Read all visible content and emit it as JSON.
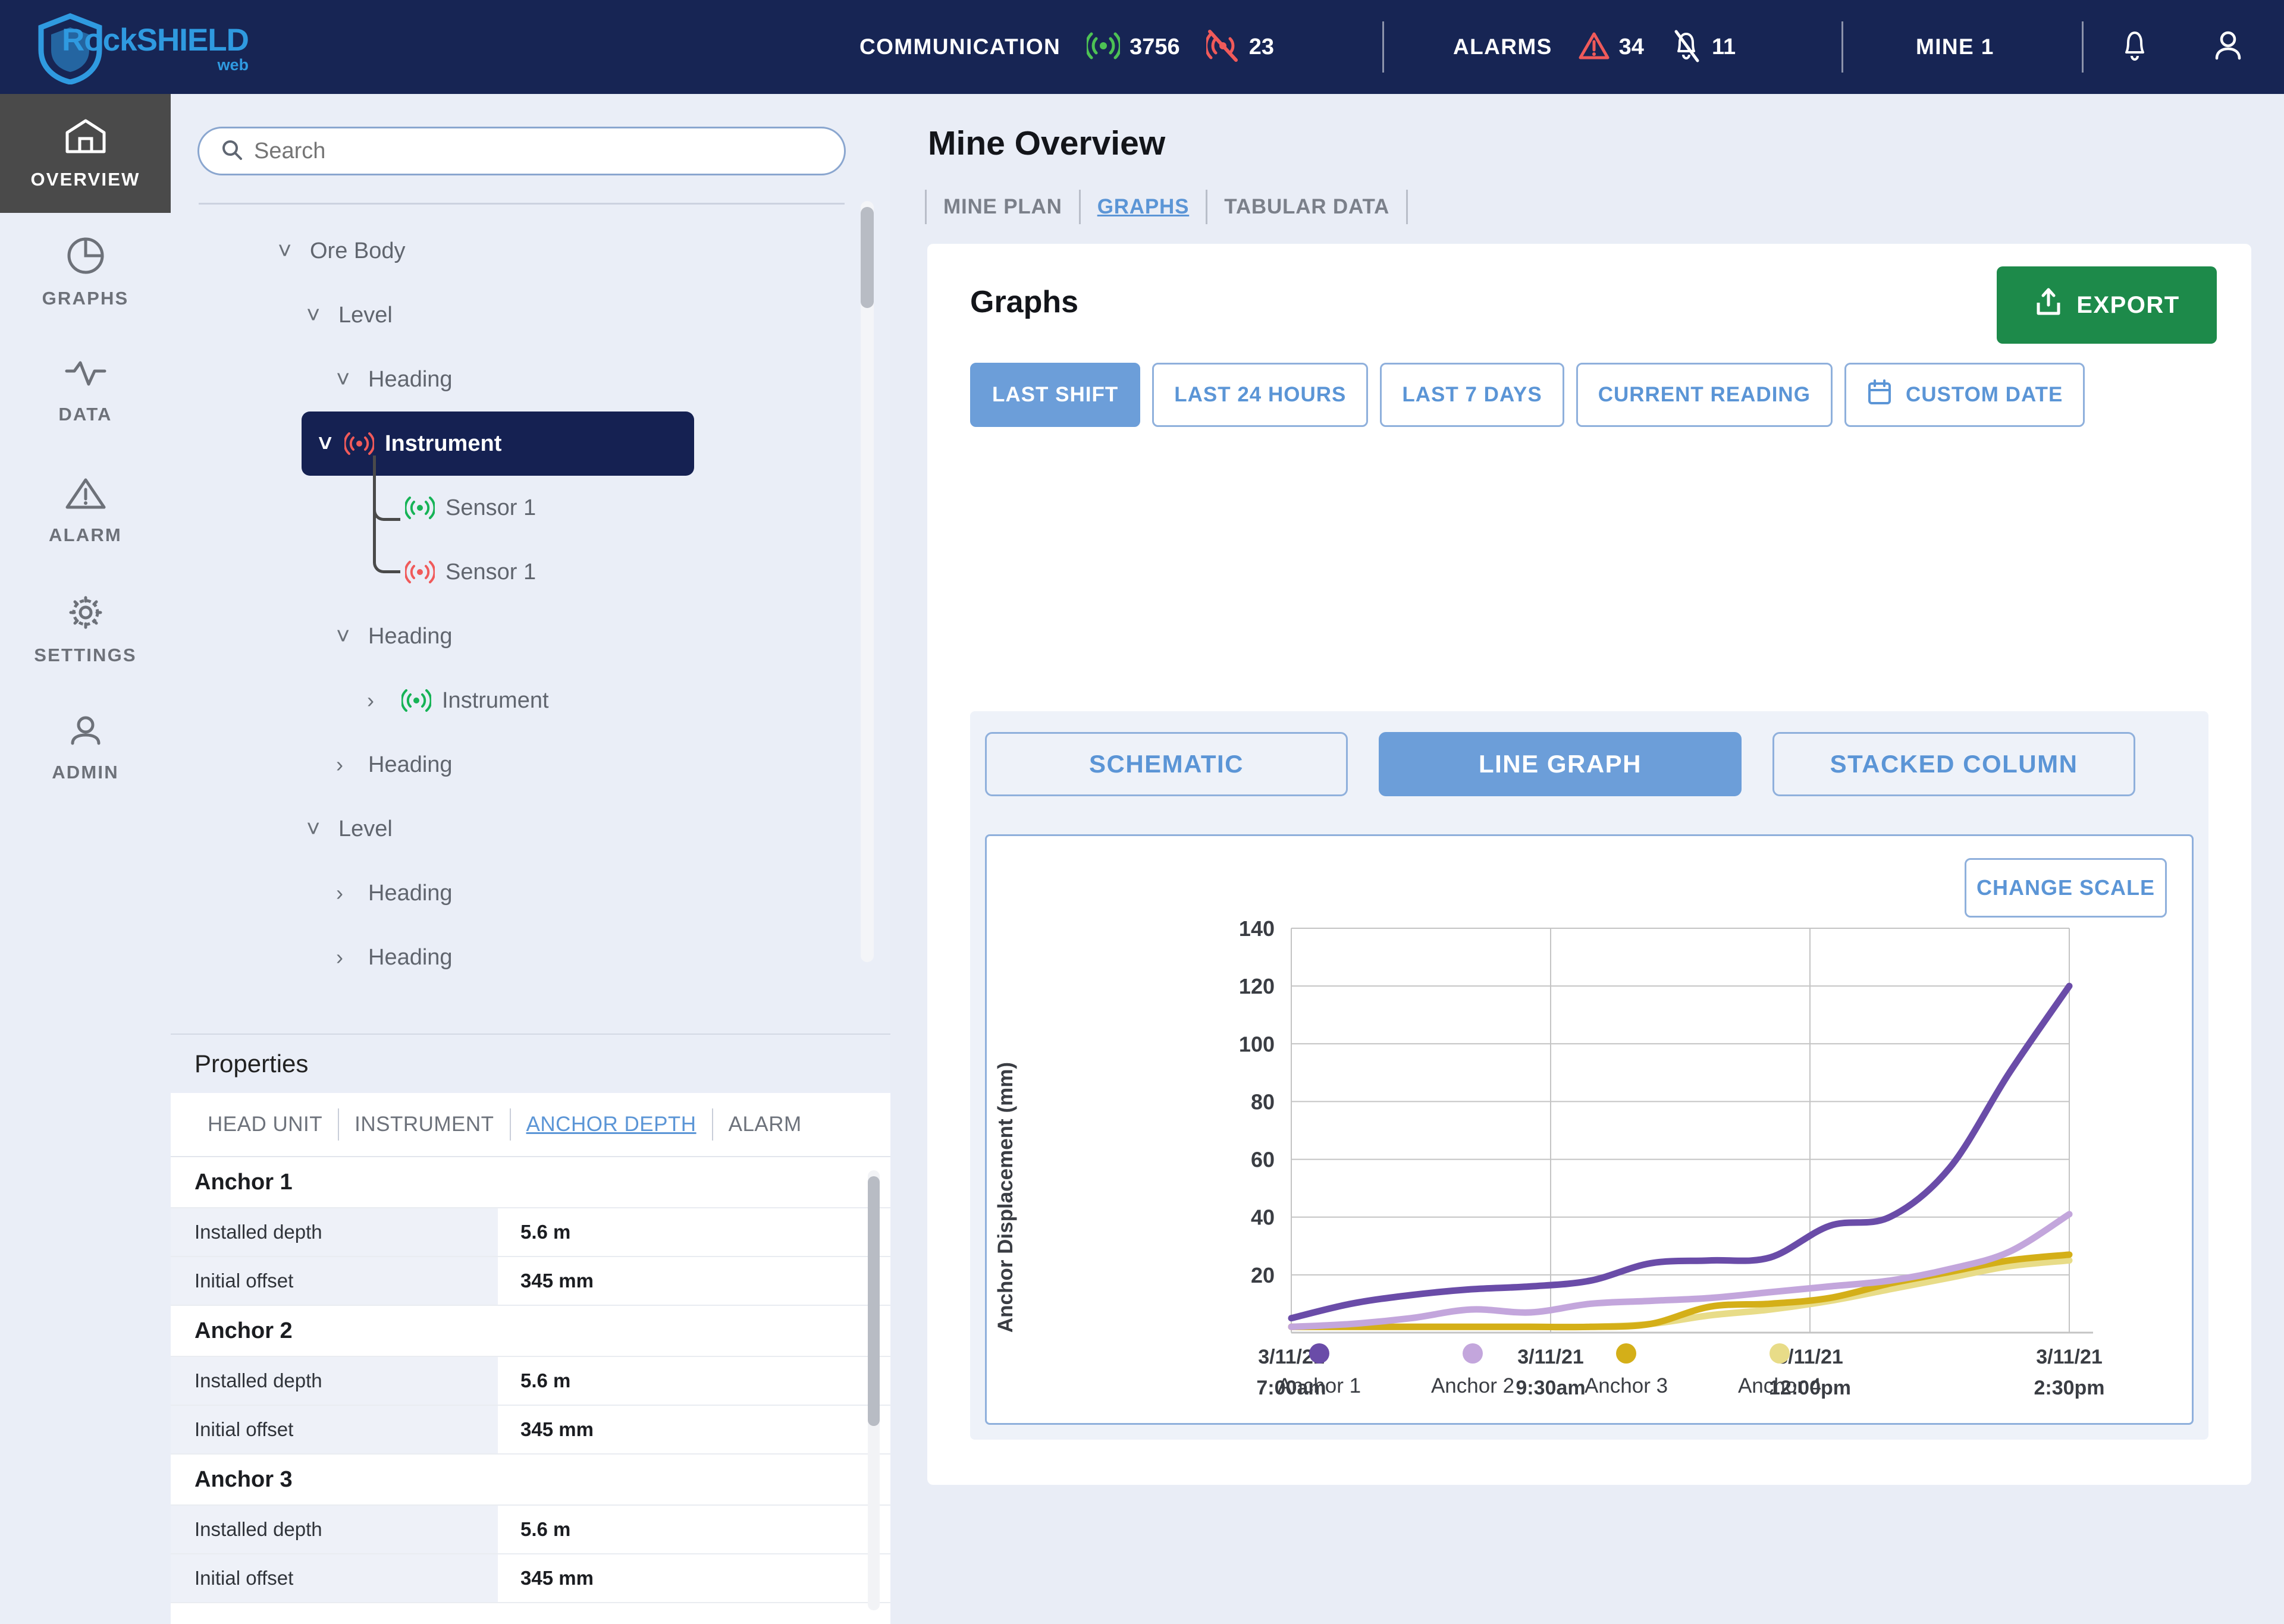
{
  "topbar": {
    "logo_main": "RockSHIELD",
    "logo_sub": "web",
    "communication_label": "COMMUNICATION",
    "comm_online": "3756",
    "comm_offline": "23",
    "alarms_label": "ALARMS",
    "alarms_active": "34",
    "alarms_muted": "11",
    "mine_label": "MINE 1"
  },
  "rail": {
    "items": [
      {
        "label": "OVERVIEW",
        "icon": "home-icon",
        "active": true
      },
      {
        "label": "GRAPHS",
        "icon": "pie-chart-icon",
        "active": false
      },
      {
        "label": "DATA",
        "icon": "waveform-icon",
        "active": false
      },
      {
        "label": "ALARM",
        "icon": "warning-triangle-icon",
        "active": false
      },
      {
        "label": "SETTINGS",
        "icon": "gear-icon",
        "active": false
      },
      {
        "label": "ADMIN",
        "icon": "user-icon",
        "active": false
      }
    ]
  },
  "search": {
    "placeholder": "Search",
    "value": ""
  },
  "tree": {
    "nodes": [
      {
        "label": "Ore Body",
        "depth": 0,
        "chev": "down",
        "signal": "none",
        "selected": false
      },
      {
        "label": "Level",
        "depth": 1,
        "chev": "down",
        "signal": "none",
        "selected": false
      },
      {
        "label": "Heading",
        "depth": 2,
        "chev": "down",
        "signal": "none",
        "selected": false
      },
      {
        "label": "Instrument",
        "depth": 3,
        "chev": "down",
        "signal": "red",
        "selected": true
      },
      {
        "label": "Sensor 1",
        "depth": 4,
        "chev": "none",
        "signal": "green",
        "selected": false
      },
      {
        "label": "Sensor 1",
        "depth": 4,
        "chev": "none",
        "signal": "red",
        "selected": false
      },
      {
        "label": "Heading",
        "depth": 2,
        "chev": "down",
        "signal": "none",
        "selected": false
      },
      {
        "label": "Instrument",
        "depth": 3,
        "chev": "right",
        "signal": "green",
        "selected": false
      },
      {
        "label": "Heading",
        "depth": 2,
        "chev": "right",
        "signal": "none",
        "selected": false
      },
      {
        "label": "Level",
        "depth": 1,
        "chev": "down",
        "signal": "none",
        "selected": false
      },
      {
        "label": "Heading",
        "depth": 2,
        "chev": "right",
        "signal": "none",
        "selected": false
      },
      {
        "label": "Heading",
        "depth": 2,
        "chev": "right",
        "signal": "none",
        "selected": false
      }
    ]
  },
  "properties": {
    "title": "Properties",
    "tabs": [
      {
        "label": "HEAD UNIT",
        "active": false
      },
      {
        "label": "INSTRUMENT",
        "active": false
      },
      {
        "label": "ANCHOR DEPTH",
        "active": true
      },
      {
        "label": "ALARM",
        "active": false
      }
    ],
    "groups": [
      {
        "name": "Anchor 1",
        "rows": [
          {
            "key": "Installed depth",
            "value": "5.6 m"
          },
          {
            "key": "Initial offset",
            "value": "345 mm"
          }
        ]
      },
      {
        "name": "Anchor 2",
        "rows": [
          {
            "key": "Installed depth",
            "value": "5.6 m"
          },
          {
            "key": "Initial offset",
            "value": "345 mm"
          }
        ]
      },
      {
        "name": "Anchor 3",
        "rows": [
          {
            "key": "Installed depth",
            "value": "5.6 m"
          },
          {
            "key": "Initial offset",
            "value": "345 mm"
          }
        ]
      }
    ]
  },
  "main": {
    "title": "Mine Overview",
    "tabs": [
      {
        "label": "MINE PLAN",
        "active": false
      },
      {
        "label": "GRAPHS",
        "active": true
      },
      {
        "label": "TABULAR DATA",
        "active": false
      }
    ],
    "card_title": "Graphs",
    "export_label": "EXPORT",
    "ranges": [
      {
        "label": "LAST SHIFT",
        "active": true,
        "icon": "none"
      },
      {
        "label": "LAST 24 HOURS",
        "active": false,
        "icon": "none"
      },
      {
        "label": "LAST 7 DAYS",
        "active": false,
        "icon": "none"
      },
      {
        "label": "CURRENT READING",
        "active": false,
        "icon": "none"
      },
      {
        "label": "CUSTOM DATE",
        "active": false,
        "icon": "calendar-icon"
      }
    ],
    "graph_tabs": [
      {
        "label": "SCHEMATIC",
        "active": false
      },
      {
        "label": "LINE GRAPH",
        "active": true
      },
      {
        "label": "STACKED COLUMN",
        "active": false
      }
    ],
    "change_scale_label": "CHANGE SCALE"
  },
  "chart_data": {
    "type": "line",
    "title": "",
    "xlabel": "",
    "ylabel": "Anchor Displacement (mm)",
    "ylim": [
      0,
      140
    ],
    "yticks": [
      20,
      40,
      60,
      80,
      100,
      120,
      140
    ],
    "grid": true,
    "legend_position": "bottom",
    "xticks": [
      {
        "date": "3/11/21",
        "time": "7:00am"
      },
      {
        "date": "3/11/21",
        "time": "9:30am"
      },
      {
        "date": "3/11/21",
        "time": "12:00pm"
      },
      {
        "date": "3/11/21",
        "time": "2:30pm"
      }
    ],
    "x": [
      0,
      1,
      2,
      3,
      4,
      5,
      6,
      7,
      8,
      9,
      10,
      11,
      12
    ],
    "series": [
      {
        "name": "Anchor 1",
        "color": "#6A4CA8",
        "values": [
          5,
          10,
          13,
          15,
          16,
          18,
          24,
          25,
          26,
          37,
          40,
          57,
          90,
          120
        ]
      },
      {
        "name": "Anchor 2",
        "color": "#C3A6DC",
        "values": [
          2,
          3,
          5,
          8,
          7,
          10,
          11,
          12,
          14,
          16,
          18,
          22,
          28,
          41
        ]
      },
      {
        "name": "Anchor 3",
        "color": "#D4AF18",
        "values": [
          2,
          2,
          2,
          2,
          2,
          2,
          3,
          9,
          10,
          12,
          17,
          21,
          25,
          27
        ]
      },
      {
        "name": "Anchor 4",
        "color": "#E8DC88",
        "values": [
          2,
          2,
          2,
          2,
          2,
          2,
          3,
          6,
          8,
          11,
          15,
          19,
          23,
          25
        ]
      }
    ]
  }
}
